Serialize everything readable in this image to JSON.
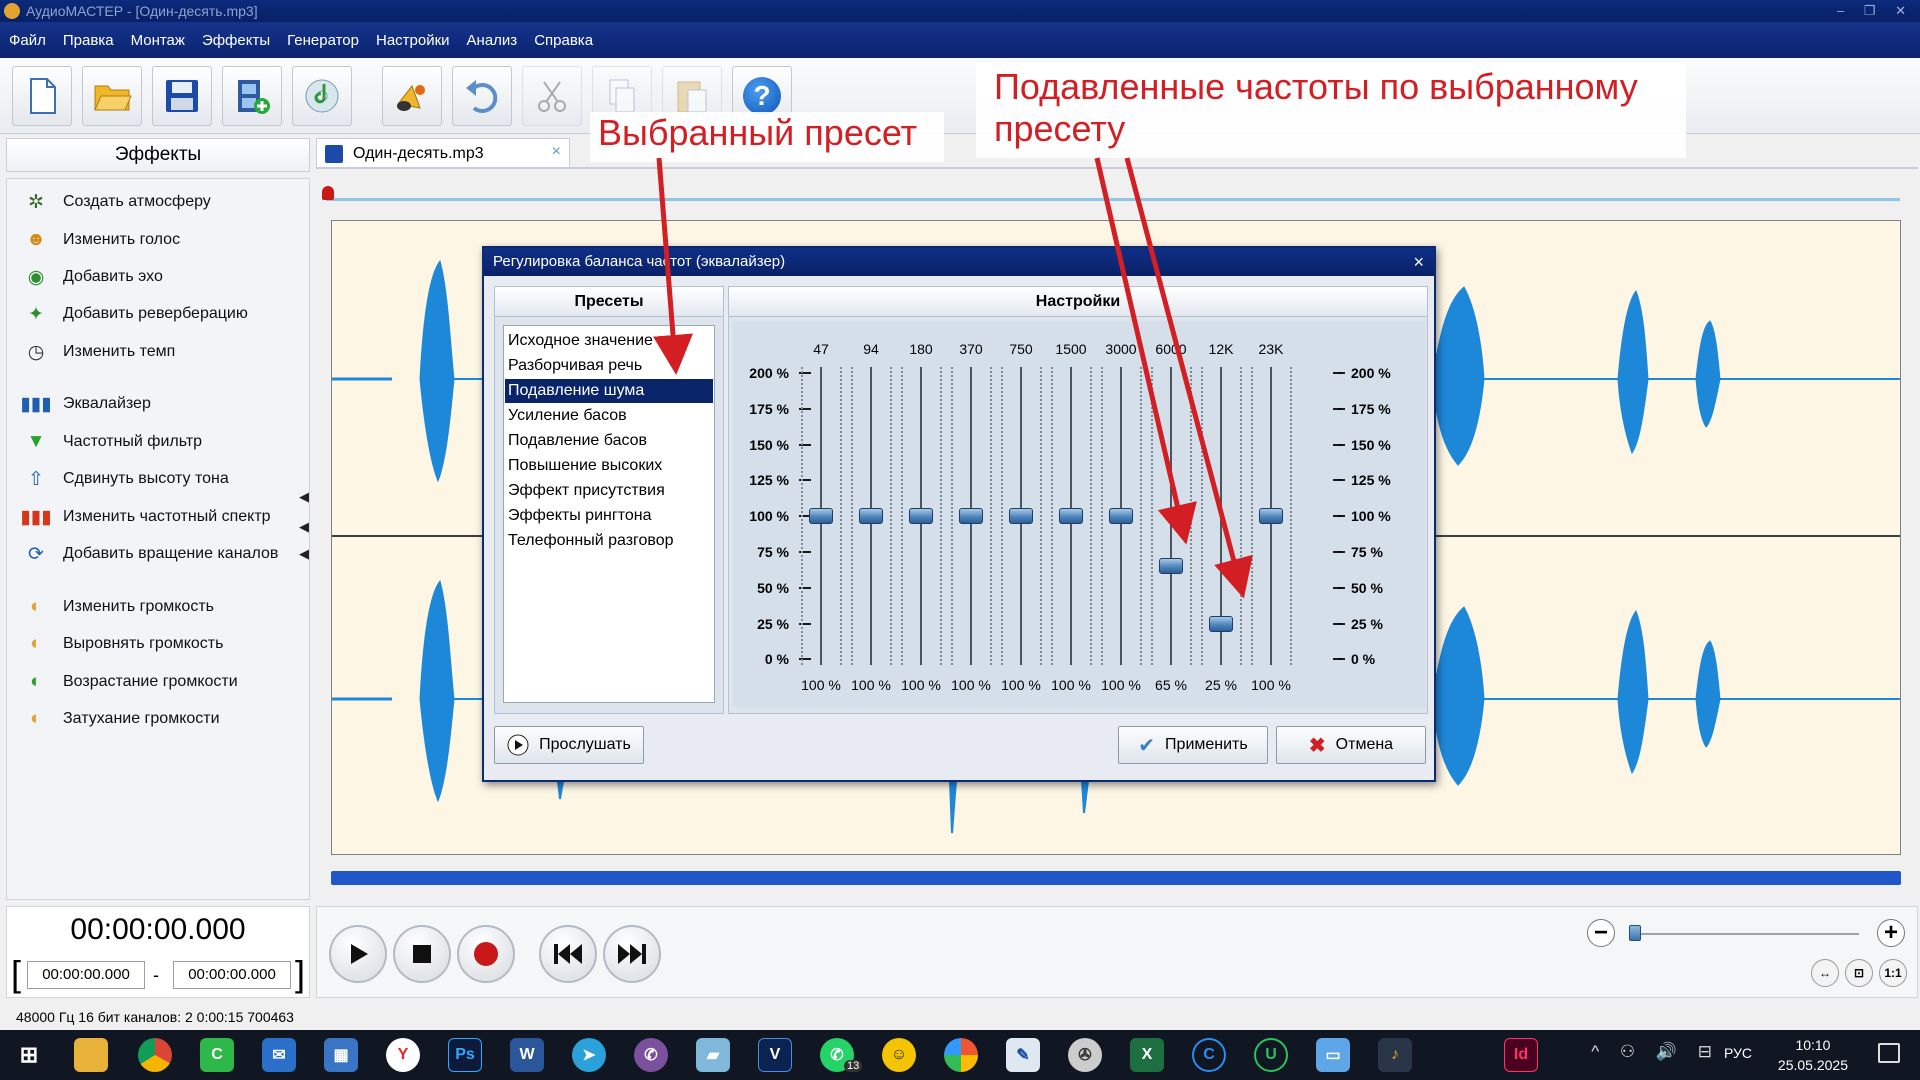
{
  "window": {
    "title": "АудиоМАСТЕР - [Один-десять.mp3]"
  },
  "menu": [
    "Файл",
    "Правка",
    "Монтаж",
    "Эффекты",
    "Генератор",
    "Настройки",
    "Анализ",
    "Справка"
  ],
  "toolbar": {
    "icons": [
      "new-file-icon",
      "open-folder-icon",
      "save-icon",
      "video-add-icon",
      "cd-music-icon",
      "speaker-note-icon",
      "undo-icon",
      "cut-icon",
      "copy-icon",
      "paste-icon",
      "help-icon"
    ],
    "help_glyph": "?"
  },
  "effects": {
    "header": "Эффекты",
    "items": [
      {
        "label": "Создать атмосферу",
        "icon": "atmosphere-icon"
      },
      {
        "label": "Изменить голос",
        "icon": "voice-icon"
      },
      {
        "label": "Добавить эхо",
        "icon": "echo-icon"
      },
      {
        "label": "Добавить реверберацию",
        "icon": "reverb-icon"
      },
      {
        "label": "Изменить темп",
        "icon": "tempo-clock-icon"
      },
      {
        "label": "Эквалайзер",
        "icon": "equalizer-icon"
      },
      {
        "label": "Частотный фильтр",
        "icon": "filter-funnel-icon"
      },
      {
        "label": "Сдвинуть высоту тона",
        "icon": "pitch-icon"
      },
      {
        "label": "Изменить частотный спектр",
        "icon": "spectrum-icon"
      },
      {
        "label": "Добавить вращение каналов",
        "icon": "rotate-channels-icon"
      },
      {
        "label": "Изменить громкость",
        "icon": "volume-icon"
      },
      {
        "label": "Выровнять громкость",
        "icon": "normalize-icon"
      },
      {
        "label": "Возрастание громкости",
        "icon": "fade-in-icon"
      },
      {
        "label": "Затухание громкости",
        "icon": "fade-out-icon"
      }
    ]
  },
  "tab": {
    "label": "Один-десять.mp3",
    "close": "×"
  },
  "time": {
    "current": "00:00:00.000",
    "start": "00:00:00.000",
    "end": "00:00:00.000",
    "open_bracket": "[",
    "close_bracket": "]",
    "dash": "-"
  },
  "zoom": {
    "minus": "−",
    "plus": "+",
    "fit": "↔",
    "selection": "⊡",
    "one_to_one": "1:1",
    "level": 0.0
  },
  "status": {
    "text": "48000 Гц  16 бит  каналов: 2   0:00:15 700463"
  },
  "taskbar": {
    "time": "10:10",
    "date": "25.05.2025",
    "lang": "РУС",
    "tray": "^ ⚇ 🔊 ⊟",
    "badge": "13"
  },
  "dialog": {
    "title": "Регулировка баланса частот (эквалайзер)",
    "close": "×",
    "presets_header": "Пресеты",
    "settings_header": "Настройки",
    "presets": [
      "Исходное значение",
      "Разборчивая речь",
      "Подавление шума",
      "Усиление басов",
      "Подавление басов",
      "Повышение высоких",
      "Эффект присутствия",
      "Эффекты рингтона",
      "Телефонный разговор"
    ],
    "selected_preset": 2,
    "scale": [
      "200 %",
      "175 %",
      "150 %",
      "125 %",
      "100 %",
      "75 %",
      "50 %",
      "25 %",
      "0 %"
    ],
    "bands": [
      {
        "freq": "47",
        "value_label": "100 %",
        "value": 100
      },
      {
        "freq": "94",
        "value_label": "100 %",
        "value": 100
      },
      {
        "freq": "180",
        "value_label": "100 %",
        "value": 100
      },
      {
        "freq": "370",
        "value_label": "100 %",
        "value": 100
      },
      {
        "freq": "750",
        "value_label": "100 %",
        "value": 100
      },
      {
        "freq": "1500",
        "value_label": "100 %",
        "value": 100
      },
      {
        "freq": "3000",
        "value_label": "100 %",
        "value": 100
      },
      {
        "freq": "6000",
        "value_label": "65 %",
        "value": 65
      },
      {
        "freq": "12K",
        "value_label": "25 %",
        "value": 25
      },
      {
        "freq": "23K",
        "value_label": "100 %",
        "value": 100
      }
    ],
    "listen": "Прослушать",
    "apply": "Применить",
    "cancel": "Отмена"
  },
  "annotations": {
    "preset": "Выбранный пресет",
    "suppressed_line1": "Подавленные частоты по выбранному",
    "suppressed_line2": "пресету",
    "color": "#d31e24"
  }
}
